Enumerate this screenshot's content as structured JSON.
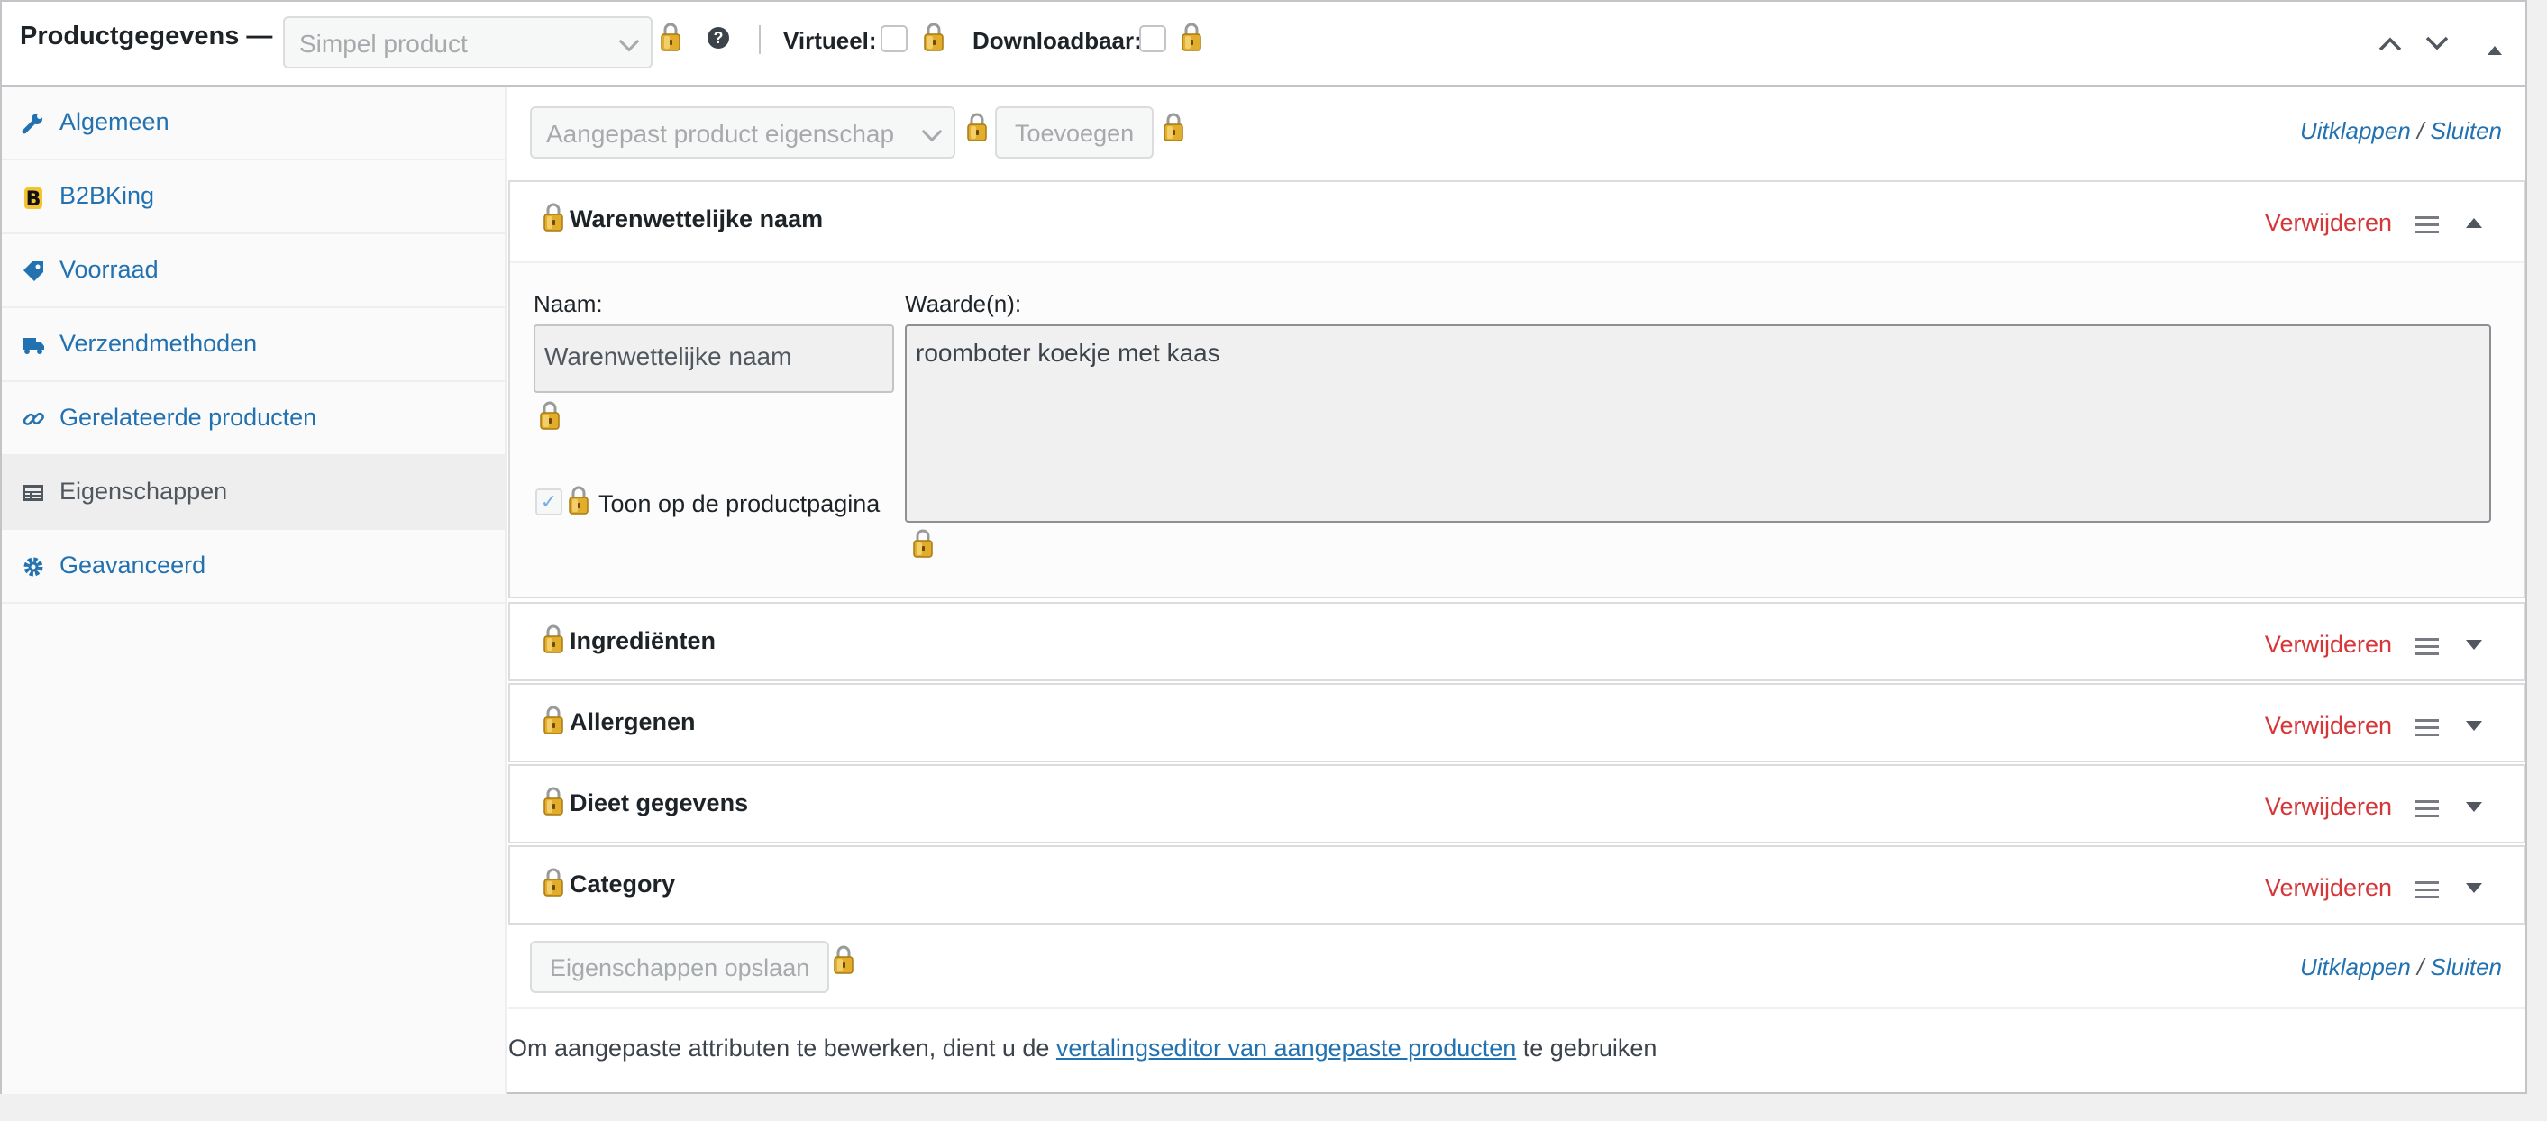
{
  "header": {
    "title": "Productgegevens —",
    "product_type": "Simpel product",
    "virtual_label": "Virtueel:",
    "downloadable_label": "Downloadbaar:",
    "help_glyph": "?"
  },
  "sidebar": {
    "items": [
      {
        "label": "Algemeen",
        "icon": "wrench-icon"
      },
      {
        "label": "B2BKing",
        "icon": "b2bking-logo-icon"
      },
      {
        "label": "Voorraad",
        "icon": "tag-icon"
      },
      {
        "label": "Verzendmethoden",
        "icon": "truck-icon"
      },
      {
        "label": "Gerelateerde producten",
        "icon": "link-icon"
      },
      {
        "label": "Eigenschappen",
        "icon": "list-table-icon",
        "active": true
      },
      {
        "label": "Geavanceerd",
        "icon": "gear-icon"
      }
    ]
  },
  "toolbar": {
    "attribute_select": "Aangepast product eigenschap",
    "add_button": "Toevoegen",
    "expand": "Uitklappen",
    "separator": "/",
    "close": "Sluiten"
  },
  "attributes": {
    "expanded": {
      "name": "Warenwettelijke naam",
      "remove": "Verwijderen",
      "name_label": "Naam:",
      "name_value": "Warenwettelijke naam",
      "values_label": "Waarde(n):",
      "values_value": "roomboter koekje met kaas",
      "visible_label": "Toon op de productpagina",
      "visible_checked": true
    },
    "collapsed": [
      {
        "name": "Ingrediënten",
        "remove": "Verwijderen"
      },
      {
        "name": "Allergenen",
        "remove": "Verwijderen"
      },
      {
        "name": "Dieet gegevens",
        "remove": "Verwijderen"
      },
      {
        "name": "Category",
        "remove": "Verwijderen"
      }
    ]
  },
  "footer": {
    "save_button": "Eigenschappen opslaan",
    "expand": "Uitklappen",
    "separator": "/",
    "close": "Sluiten",
    "note_prefix": "Om aangepaste attributen te bewerken, dient u de ",
    "note_link": "vertalingseditor van aangepaste producten",
    "note_suffix": " te gebruiken"
  },
  "colors": {
    "link": "#2271b1",
    "remove": "#d63638",
    "lock_gold": "#d9a520"
  }
}
